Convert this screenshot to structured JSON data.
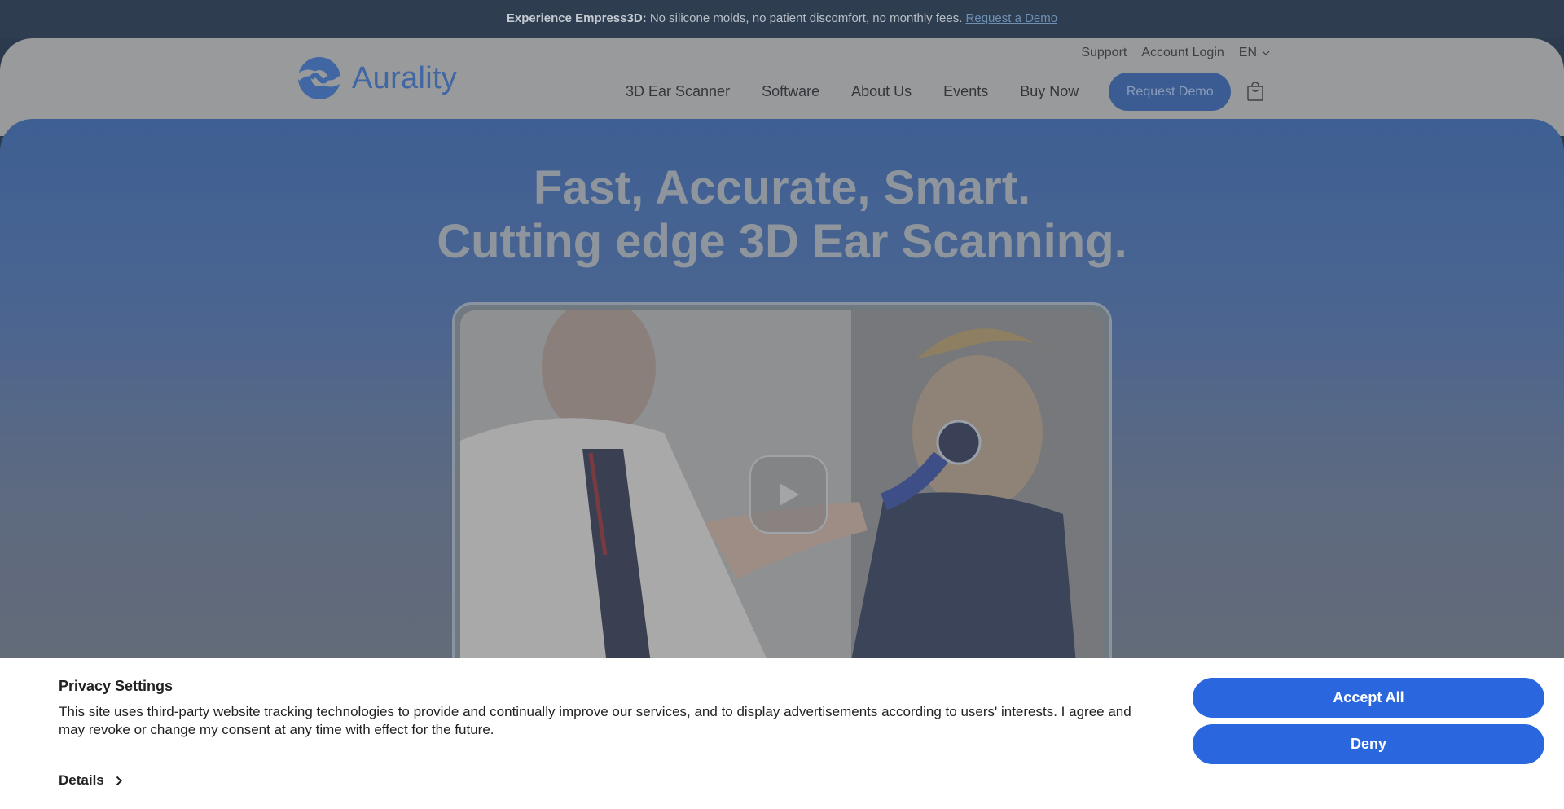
{
  "promo": {
    "bold": "Experience Empress3D:",
    "text": " No silicone molds, no patient discomfort, no monthly fees. ",
    "link": "Request a Demo"
  },
  "header": {
    "logo_text": "Aurality",
    "utility": {
      "support": "Support",
      "login": "Account Login",
      "lang": "EN"
    },
    "nav": [
      "3D Ear Scanner",
      "Software",
      "About Us",
      "Events",
      "Buy Now"
    ],
    "cta": "Request Demo"
  },
  "hero": {
    "line1": "Fast, Accurate, Smart.",
    "line2": "Cutting edge 3D Ear Scanning."
  },
  "cookie": {
    "title": "Privacy Settings",
    "text": "This site uses third-party website tracking technologies to provide and continually improve our services, and to display advertisements according to users' interests. I agree and may revoke or change my consent at any time with effect for the future.",
    "details": "Details",
    "accept": "Accept All",
    "deny": "Deny"
  },
  "icons": {
    "logo": "aurality-logo-icon",
    "lang_chevron": "chevron-down-icon",
    "cart": "shopping-bag-icon",
    "play": "play-icon",
    "details_chevron": "chevron-right-icon"
  },
  "colors": {
    "brand": "#4066a3",
    "button": "#2a67de"
  }
}
